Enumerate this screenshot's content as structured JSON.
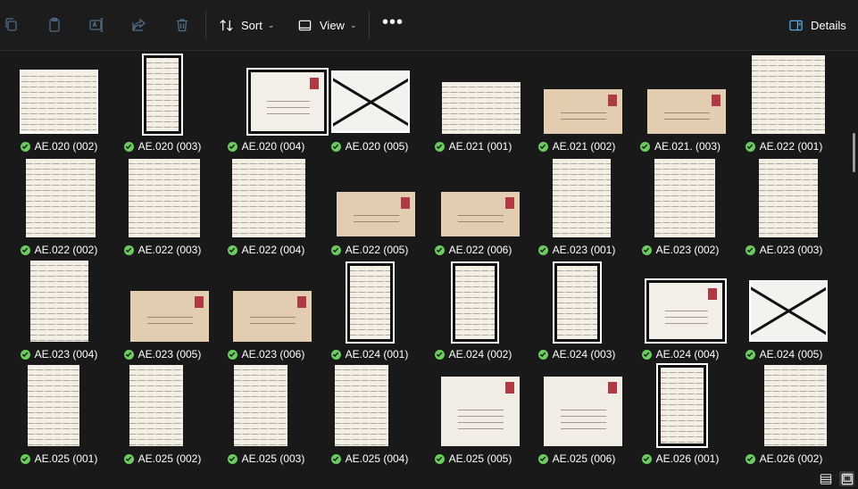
{
  "toolbar": {
    "sort_label": "Sort",
    "view_label": "View",
    "more_label": "•••",
    "details_label": "Details",
    "icons": [
      "copy-icon",
      "paste-icon",
      "rename-icon",
      "share-icon",
      "delete-icon",
      "sort-icon",
      "view-icon",
      "details-pane-icon"
    ]
  },
  "files": [
    {
      "name": "AE.020 (002)",
      "kind": "letter"
    },
    {
      "name": "AE.020 (003)",
      "kind": "letter"
    },
    {
      "name": "AE.020 (004)",
      "kind": "envelope-black"
    },
    {
      "name": "AE.020 (005)",
      "kind": "envelope-cross"
    },
    {
      "name": "AE.021 (001)",
      "kind": "letter"
    },
    {
      "name": "AE.021 (002)",
      "kind": "envelope"
    },
    {
      "name": "AE.021. (003)",
      "kind": "envelope"
    },
    {
      "name": "AE.022 (001)",
      "kind": "letter"
    },
    {
      "name": "AE.022 (002)",
      "kind": "letter"
    },
    {
      "name": "AE.022 (003)",
      "kind": "letter"
    },
    {
      "name": "AE.022 (004)",
      "kind": "letter"
    },
    {
      "name": "AE.022 (005)",
      "kind": "envelope"
    },
    {
      "name": "AE.022 (006)",
      "kind": "envelope"
    },
    {
      "name": "AE.023 (001)",
      "kind": "letter"
    },
    {
      "name": "AE.023 (002)",
      "kind": "letter"
    },
    {
      "name": "AE.023 (003)",
      "kind": "letter"
    },
    {
      "name": "AE.023 (004)",
      "kind": "letter"
    },
    {
      "name": "AE.023 (005)",
      "kind": "envelope"
    },
    {
      "name": "AE.023 (006)",
      "kind": "envelope"
    },
    {
      "name": "AE.024 (001)",
      "kind": "letter"
    },
    {
      "name": "AE.024 (002)",
      "kind": "letter"
    },
    {
      "name": "AE.024 (003)",
      "kind": "letter"
    },
    {
      "name": "AE.024 (004)",
      "kind": "envelope-black"
    },
    {
      "name": "AE.024 (005)",
      "kind": "envelope-cross"
    },
    {
      "name": "AE.025 (001)",
      "kind": "letter"
    },
    {
      "name": "AE.025 (002)",
      "kind": "letter"
    },
    {
      "name": "AE.025 (003)",
      "kind": "letter"
    },
    {
      "name": "AE.025 (004)",
      "kind": "letter"
    },
    {
      "name": "AE.025 (005)",
      "kind": "envelope-light"
    },
    {
      "name": "AE.025 (006)",
      "kind": "envelope-light"
    },
    {
      "name": "AE.026 (001)",
      "kind": "letter"
    },
    {
      "name": "AE.026 (002)",
      "kind": "letter"
    }
  ],
  "status": {
    "sync_icon": "sync-ok-check-icon",
    "view_modes": [
      "details-view-icon",
      "large-icons-view-icon"
    ],
    "active_view": "large-icons-view-icon"
  },
  "colors": {
    "background": "#191919",
    "toolbar": "#1c1c1c",
    "sync_check": "#6ccb5f",
    "stamp": "#b03a43"
  }
}
